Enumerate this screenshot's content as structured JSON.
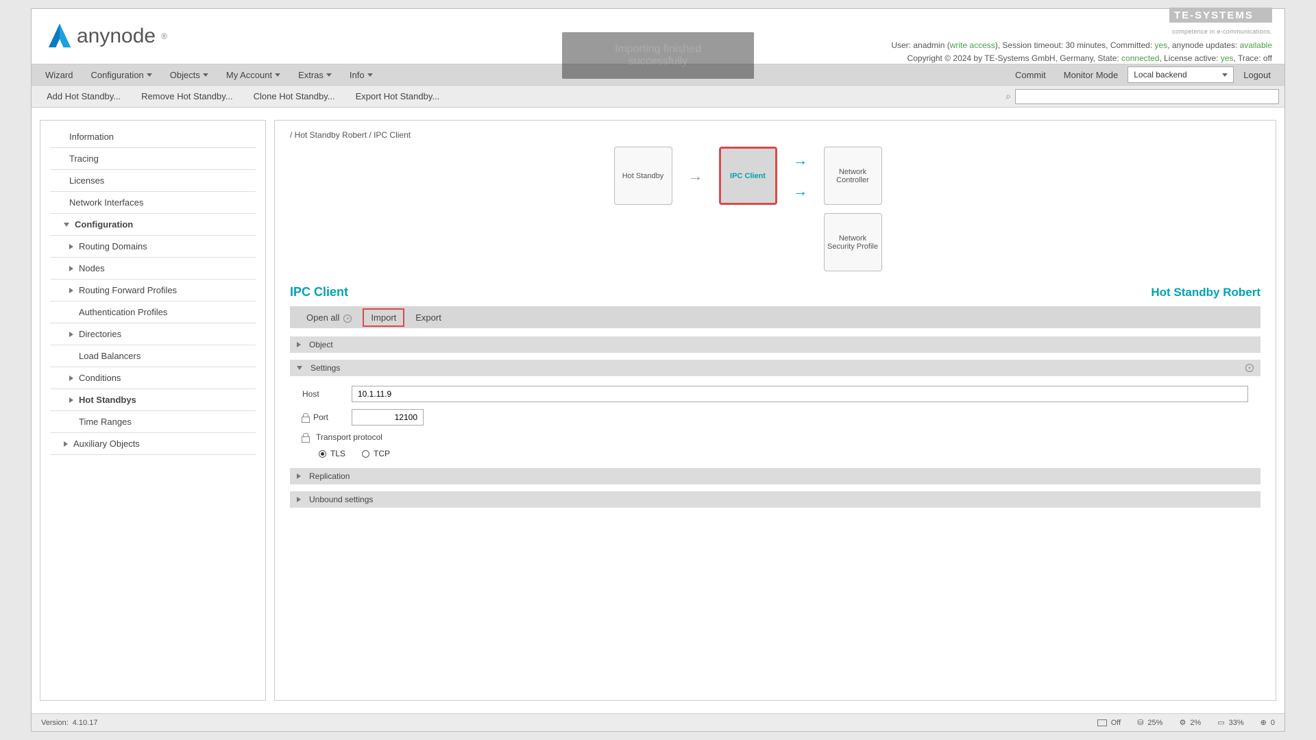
{
  "brand": {
    "name": "anynode"
  },
  "header_info": {
    "tesys_sub": "competence in e-communications.",
    "line1_a": "User: anadmin (",
    "line1_access": "write access",
    "line1_b": "), Session timeout: 30 minutes, Committed: ",
    "line1_committed": "yes",
    "line1_c": ", anynode updates: ",
    "line1_updates": "available",
    "line2_a": "Copyright © 2024 by TE-Systems GmbH, Germany, State: ",
    "line2_state": "connected",
    "line2_b": ", License active: ",
    "line2_lic": "yes",
    "line2_c": ", Trace: off"
  },
  "toast": "Importing finished successfully",
  "menu": {
    "wizard": "Wizard",
    "configuration": "Configuration",
    "objects": "Objects",
    "myaccount": "My Account",
    "extras": "Extras",
    "info": "Info",
    "commit": "Commit",
    "monitor": "Monitor Mode",
    "backend": "Local backend",
    "logout": "Logout"
  },
  "toolbar": {
    "add": "Add Hot Standby...",
    "remove": "Remove Hot Standby...",
    "clone": "Clone Hot Standby...",
    "export": "Export Hot Standby..."
  },
  "sidebar": {
    "information": "Information",
    "tracing": "Tracing",
    "licenses": "Licenses",
    "network": "Network Interfaces",
    "configuration": "Configuration",
    "routing_domains": "Routing Domains",
    "nodes": "Nodes",
    "routing_forward": "Routing Forward Profiles",
    "auth": "Authentication Profiles",
    "directories": "Directories",
    "load_balancers": "Load Balancers",
    "conditions": "Conditions",
    "hot_standbys": "Hot Standbys",
    "time_ranges": "Time Ranges",
    "auxiliary": "Auxiliary Objects"
  },
  "breadcrumb": "/ Hot Standby Robert / IPC Client",
  "diagram": {
    "hotstandby": "Hot Standby",
    "ipc": "IPC Client",
    "netcontroller": "Network Controller",
    "netsec": "Network Security Profile"
  },
  "titles": {
    "page": "IPC Client",
    "sub": "Hot Standby Robert"
  },
  "actions": {
    "open_all": "Open all",
    "import": "Import",
    "export": "Export"
  },
  "sections": {
    "object": "Object",
    "settings": "Settings",
    "replication": "Replication",
    "unbound": "Unbound settings"
  },
  "settings": {
    "host_label": "Host",
    "host_value": "10.1.11.9",
    "port_label": "Port",
    "port_value": "12100",
    "transport_label": "Transport protocol",
    "tls": "TLS",
    "tcp": "TCP"
  },
  "footer": {
    "version_label": "Version:",
    "version": "4.10.17",
    "off": "Off",
    "disk": "25%",
    "cpu": "2%",
    "mem": "33%",
    "conn": "0"
  }
}
